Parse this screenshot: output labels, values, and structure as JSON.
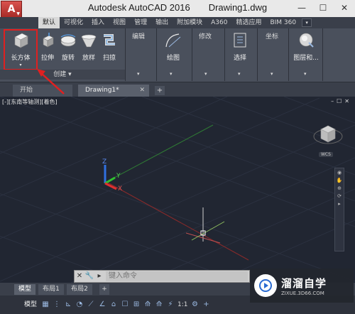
{
  "window": {
    "app_name": "Autodesk AutoCAD 2016",
    "file_name": "Drawing1.dwg",
    "min": "—",
    "max": "☐",
    "close": "✕"
  },
  "ribbon_tabs": [
    "默认",
    "可视化",
    "插入",
    "视图",
    "管理",
    "输出",
    "附加模块",
    "A360",
    "精选应用",
    "BIM 360"
  ],
  "ribbon_tab_option": "▾",
  "ribbon": {
    "create_tools": [
      {
        "name": "box",
        "label": "长方体"
      },
      {
        "name": "extrude",
        "label": "拉伸"
      },
      {
        "name": "revolve",
        "label": "旋转"
      },
      {
        "name": "loft",
        "label": "放样"
      },
      {
        "name": "sweep",
        "label": "扫掠"
      }
    ],
    "create_panel_title": "创建",
    "edit_group": "编辑",
    "draw_label": "绘图",
    "modify_group": "修改",
    "select_label": "选择",
    "coord_group": "坐标",
    "layers_label": "图层和...",
    "dropdown": "▾"
  },
  "doc_tabs": {
    "start": "开始",
    "drawing": "Drawing1*",
    "close": "✕",
    "add": "+"
  },
  "viewport": {
    "label": "[-][东南等轴测][着色]",
    "controls": [
      "–",
      "☐",
      "✕"
    ],
    "wcs": "WCS",
    "nav_buttons": [
      "◉",
      "✋",
      "⊕",
      "⟳",
      "▸"
    ],
    "axis_x": "X",
    "axis_y": "Y",
    "axis_z": "Z"
  },
  "command_line": {
    "close": "✕",
    "tool": "🔧",
    "prompt": "▸",
    "placeholder": "键入命令"
  },
  "layout_tabs": [
    "模型",
    "布局1",
    "布局2",
    "+"
  ],
  "status_bar": {
    "model": "模型",
    "buttons": [
      "▦",
      "⋮",
      "⊾",
      "◔",
      "⟋",
      "∠",
      "⌂",
      "☐",
      "⊞",
      "⟰",
      "⟰",
      "⚡",
      "1:1",
      "⚙",
      "+",
      "⊕",
      "⊡",
      "▣",
      "≡"
    ]
  },
  "watermark": {
    "title": "溜溜自学",
    "url": "ZIXUE.3D66.COM"
  },
  "colors": {
    "viewport_bg": "#212632",
    "ribbon_bg": "#4a505c",
    "highlight_red": "#e02020",
    "x_axis": "#e03030",
    "y_axis": "#30c030",
    "z_axis": "#3070e0"
  }
}
